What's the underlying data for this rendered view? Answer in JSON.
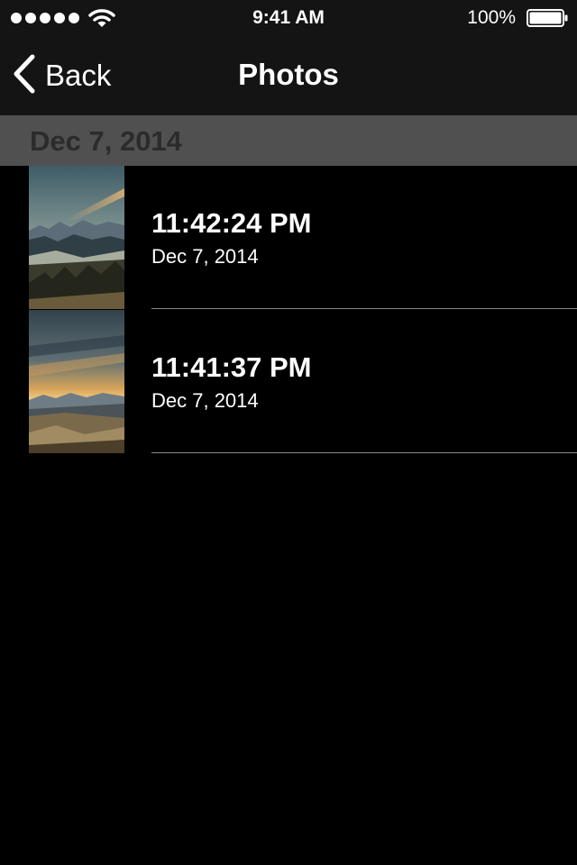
{
  "status_bar": {
    "time": "9:41 AM",
    "battery": "100%",
    "icons": [
      "signal-dots-icon",
      "wifi-icon",
      "battery-icon"
    ]
  },
  "nav": {
    "back_label": "Back",
    "title": "Photos",
    "back_icon": "chevron-left-icon"
  },
  "section": {
    "title": "Dec 7, 2014"
  },
  "photos": [
    {
      "time": "11:42:24 PM",
      "date": "Dec 7, 2014"
    },
    {
      "time": "11:41:37 PM",
      "date": "Dec 7, 2014"
    }
  ],
  "colors": {
    "background": "#000000",
    "bar": "#141414",
    "section_header": "#505050",
    "section_text": "#2b2b2b",
    "separator": "#8a8a8a"
  }
}
